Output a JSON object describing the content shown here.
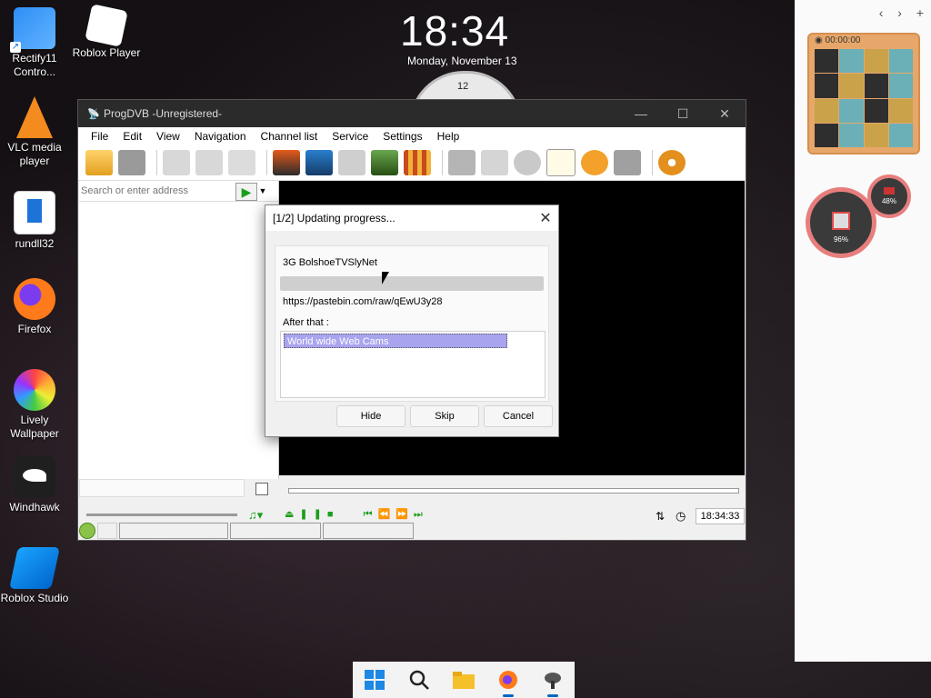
{
  "desktop": {
    "icons": [
      {
        "label": "Rectify11 Contro...",
        "icon": "windows-logo-icon"
      },
      {
        "label": "Roblox Player",
        "icon": "roblox-icon"
      },
      {
        "label": "VLC media player",
        "icon": "vlc-cone-icon"
      },
      {
        "label": "rundll32",
        "icon": "document-icon"
      },
      {
        "label": "Firefox",
        "icon": "firefox-icon"
      },
      {
        "label": "Lively Wallpaper",
        "icon": "lively-icon"
      },
      {
        "label": "Windhawk",
        "icon": "eagle-icon"
      },
      {
        "label": "Roblox Studio",
        "icon": "roblox-studio-icon"
      }
    ]
  },
  "clock": {
    "time": "18:34",
    "date": "Monday, November 13",
    "analog_top": "12"
  },
  "widgets": {
    "nav_prev": "‹",
    "nav_next": "›",
    "nav_add": "+",
    "puzzle_timer": "00:00:00",
    "gauge_big": "96%",
    "gauge_small": "48%"
  },
  "window": {
    "title": "ProgDVB -Unregistered-",
    "menu": [
      "File",
      "Edit",
      "View",
      "Navigation",
      "Channel list",
      "Service",
      "Settings",
      "Help"
    ],
    "search_placeholder": "Search or enter address",
    "time_display": "18:34:33"
  },
  "dialog": {
    "title": "[1/2] Updating progress...",
    "channel": "3G BolshoeTVSlyNet",
    "progress_percent": 0,
    "url": "https://pastebin.com/raw/qEwU3y28",
    "after_label": "After that :",
    "list_items": [
      "World wide Web Cams"
    ],
    "buttons": {
      "hide": "Hide",
      "skip": "Skip",
      "cancel": "Cancel"
    }
  },
  "colors": {
    "accent": "#0067c0",
    "selection": "#a9a4ee",
    "play_green": "#1a9e1a"
  }
}
